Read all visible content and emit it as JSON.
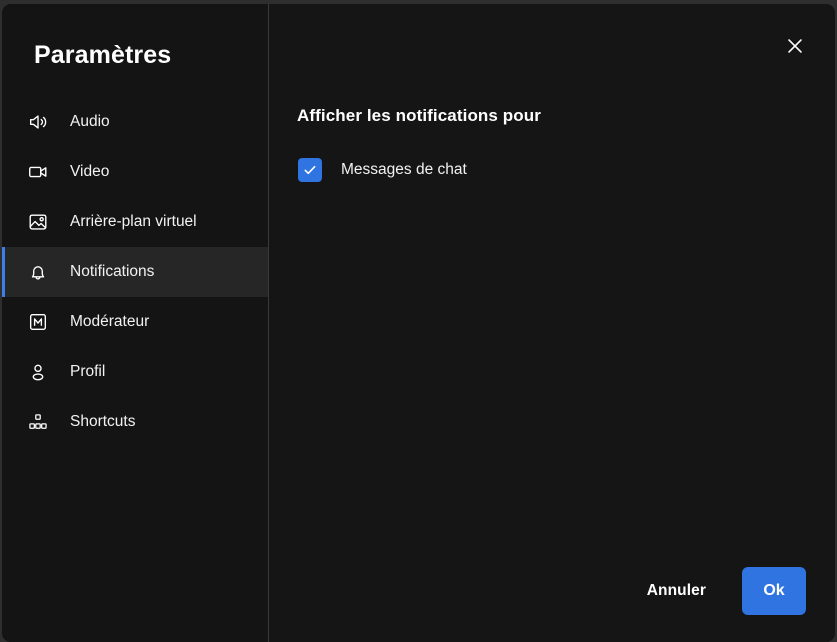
{
  "dialog": {
    "title": "Paramètres",
    "close_icon": "close-icon",
    "accent_color": "#3d7fe8",
    "primary_button_color": "#2f74e0",
    "background_color": "#151515",
    "sidebar_background_color": "#141414",
    "active_item_background_color": "#262626"
  },
  "sidebar": {
    "items": [
      {
        "label": "Audio",
        "icon": "speaker-icon",
        "active": false
      },
      {
        "label": "Video",
        "icon": "video-camera-icon",
        "active": false
      },
      {
        "label": "Arrière-plan virtuel",
        "icon": "image-icon",
        "active": false
      },
      {
        "label": "Notifications",
        "icon": "bell-icon",
        "active": true
      },
      {
        "label": "Modérateur",
        "icon": "moderator-m-icon",
        "active": false
      },
      {
        "label": "Profil",
        "icon": "person-icon",
        "active": false
      },
      {
        "label": "Shortcuts",
        "icon": "shortcuts-icon",
        "active": false
      }
    ]
  },
  "main": {
    "section_title": "Afficher les notifications pour",
    "options": [
      {
        "label": "Messages de chat",
        "checked": true
      }
    ]
  },
  "footer": {
    "cancel_label": "Annuler",
    "ok_label": "Ok"
  }
}
